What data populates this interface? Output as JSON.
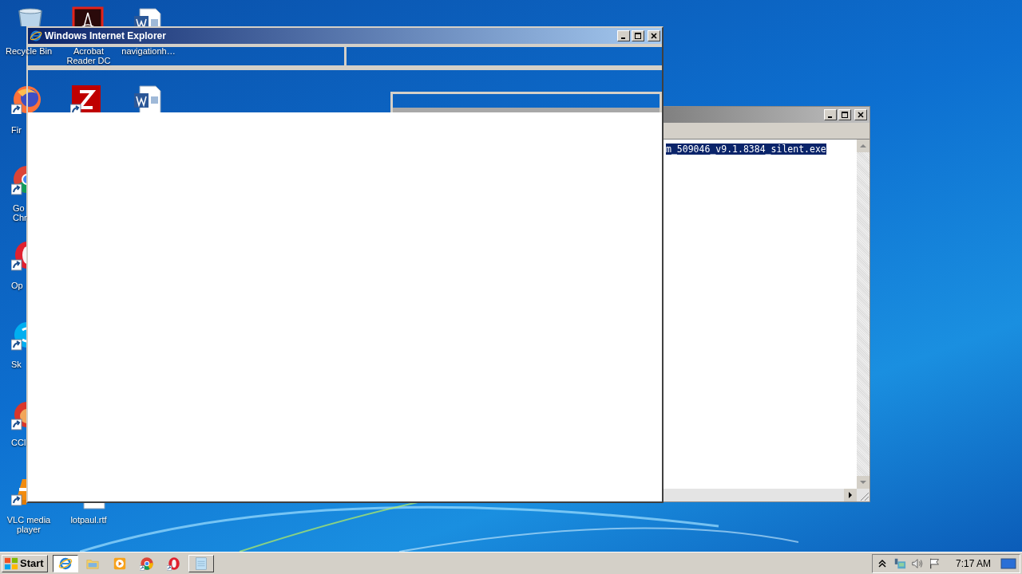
{
  "desktop_icons": [
    {
      "kind": "bin",
      "label": "Recycle Bin"
    },
    {
      "kind": "acrobat",
      "label": "Acrobat Reader DC"
    },
    {
      "kind": "word",
      "label": "navigationh…"
    },
    {
      "kind": "firefox",
      "label": "Fir"
    },
    {
      "kind": "filezilla"
    },
    {
      "kind": "word"
    },
    {
      "kind": "chrome",
      "label": "Go Chr"
    },
    {
      "kind": "opera",
      "label": "Op"
    },
    {
      "kind": "skype",
      "label": "Sk"
    },
    {
      "kind": "ccleaner",
      "label": "CCl"
    },
    {
      "kind": "vlc",
      "label": "VLC media player"
    },
    {
      "kind": "rtf",
      "label": "lotpaul.rtf"
    }
  ],
  "notepad": {
    "text": "m_509046_v9.1.8384_silent.exe",
    "text_selected": true
  },
  "browser_window": {
    "title": "Windows Internet Explorer"
  },
  "taskbar": {
    "start_label": "Start",
    "items": [
      {
        "kind": "ie",
        "open": true,
        "selected": true
      },
      {
        "kind": "folder",
        "open": false,
        "selected": false
      },
      {
        "kind": "media",
        "open": false,
        "selected": false
      },
      {
        "kind": "chrome",
        "open": false,
        "selected": false
      },
      {
        "kind": "opera",
        "open": false,
        "selected": false
      },
      {
        "kind": "notepad",
        "open": true,
        "selected": false
      }
    ],
    "clock": "7:17 AM"
  }
}
